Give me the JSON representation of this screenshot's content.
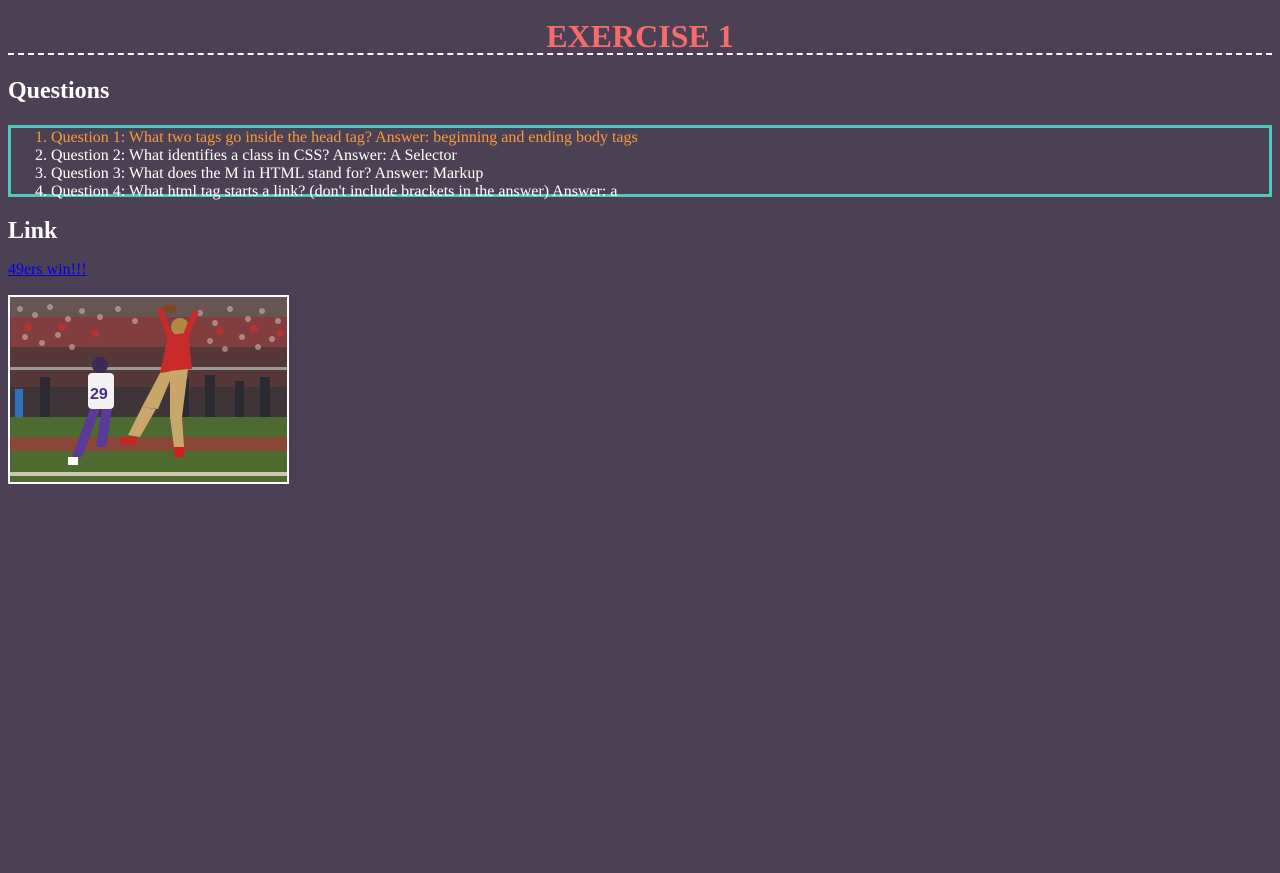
{
  "header": {
    "title": "EXERCISE 1"
  },
  "questions": {
    "heading": "Questions",
    "items": [
      "Question 1: What two tags go inside the head tag? Answer: beginning and ending body tags",
      "Question 2: What identifies a class in CSS? Answer: A Selector",
      "Question 3: What does the M in HTML stand for? Answer: Markup",
      "Question 4: What html tag starts a link? (don't include brackets in the answer) Answer: a"
    ]
  },
  "link_section": {
    "heading": "Link",
    "link_text": "49ers win!!!"
  },
  "photo": {
    "subject": "football-catch-photo"
  },
  "colors": {
    "background": "#4c4154",
    "title": "#f46c6c",
    "highlight": "#f39a45",
    "box_border": "#4fc9c0",
    "link": "#0000ee"
  }
}
